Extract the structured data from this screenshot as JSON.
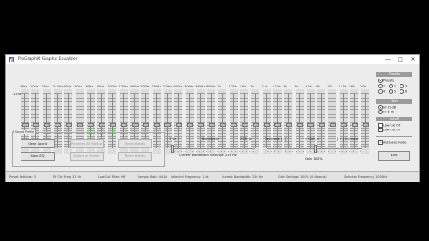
{
  "window": {
    "title": "ProGraphiX Graphic Equalizer",
    "minimize": "—",
    "maximize": "□",
    "close": "✕"
  },
  "eq": {
    "freqs": [
      "16Hz",
      "20Hz",
      "25Hz",
      "31.5Hz",
      "40Hz",
      "50Hz",
      "63Hz",
      "80Hz",
      "100Hz",
      "125Hz",
      "160Hz",
      "200Hz",
      "250Hz",
      "315Hz",
      "400Hz",
      "500Hz",
      "630Hz",
      "800Hz",
      "1k",
      "1.25k",
      "1.6k",
      "2k",
      "2.5k",
      "3.15k",
      "4k",
      "5k",
      "6.3k",
      "8k",
      "10k",
      "12.5k",
      "16k",
      "20k"
    ],
    "max_label": "+12dB",
    "min_label": "-12dB",
    "boosted_bands": [
      6,
      7,
      8,
      9
    ]
  },
  "freqpanel": {
    "group_label": "Sound Profile",
    "btn_clear": "Clear Sound",
    "btn_program": "Program EQ Rating",
    "btn_reset": "Reset Bands",
    "btn_save": "Save EQ",
    "btn_export": "Export as Preset"
  },
  "bandwidth": {
    "min": "1 Hz",
    "label": "Bandwidth",
    "max": "256 Hz",
    "current": "Current Bandwidth Settings: 256 Hz"
  },
  "gain": {
    "decrease": "Decrease [ - ]",
    "label": "< Gain >",
    "increase": "[ + ] Increase",
    "value": "Gain 100%"
  },
  "right_panel": {
    "presets_header": "Presets",
    "presets_title": "Presets",
    "presets": [
      "1",
      "2",
      "3",
      "4",
      "5",
      "6",
      "7",
      "8"
    ],
    "filter_header": "Filter",
    "filter_options": [
      "Hi 12 dB",
      "Hi 6 dB",
      "Lo 6 dB"
    ],
    "cutoff_header": "Cutoff",
    "cutoff_options": [
      "Low Cut Off",
      "Low Cut Off"
    ],
    "auto_save": "Autosave Mode",
    "exit": "Exit"
  },
  "statusbar": {
    "items": [
      "Preset Settings: 3",
      "Eff Ctrl Freq: 31 Hz",
      "Low Cut Filter: Off",
      "Hi Cut Filter: Off",
      "Sample Rate: 44.1k",
      "Selected Frequency: 1.0k",
      "Current Bandwidth: 256 Hz",
      "Gain Settings: 100% (0 Gbands)",
      "Selected Frequency: 1000Hz"
    ]
  }
}
